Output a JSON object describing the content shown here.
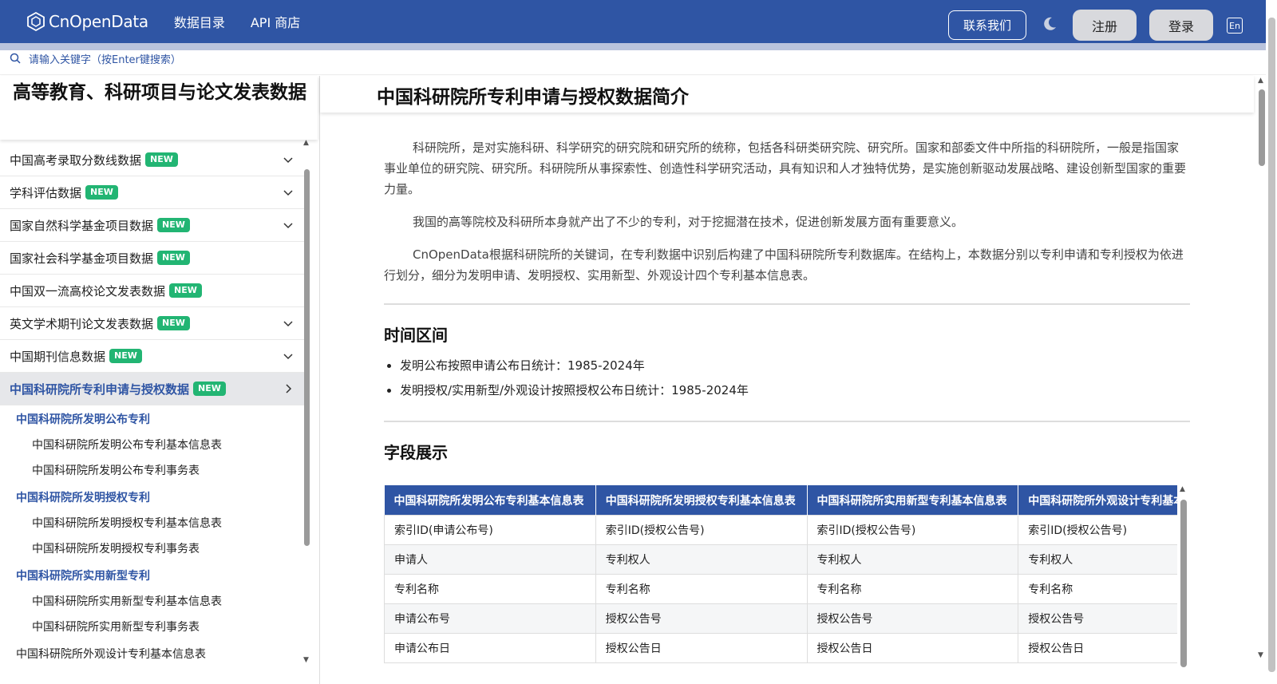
{
  "header": {
    "logo_text": "CnOpenData",
    "nav": [
      "数据目录",
      "API 商店"
    ],
    "contact": "联系我们",
    "register": "注册",
    "login": "登录",
    "lang": "En"
  },
  "search": {
    "placeholder": "请输入关键字（按Enter键搜索）"
  },
  "sidebar": {
    "title": "高等教育、科研项目与论文发表数据",
    "items": [
      {
        "label": "中国高考录取分数线数据",
        "badge": "NEW"
      },
      {
        "label": "学科评估数据",
        "badge": "NEW"
      },
      {
        "label": "国家自然科学基金项目数据",
        "badge": "NEW"
      },
      {
        "label": "国家社会科学基金项目数据",
        "badge": "NEW"
      },
      {
        "label": "中国双一流高校论文发表数据",
        "badge": "NEW"
      },
      {
        "label": "英文学术期刊论文发表数据",
        "badge": "NEW"
      },
      {
        "label": "中国期刊信息数据",
        "badge": "NEW"
      },
      {
        "label": "中国科研院所专利申请与授权数据",
        "badge": "NEW"
      }
    ],
    "sub": {
      "group1": "中国科研院所发明公布专利",
      "group1_items": [
        "中国科研院所发明公布专利基本信息表",
        "中国科研院所发明公布专利事务表"
      ],
      "group2": "中国科研院所发明授权专利",
      "group2_items": [
        "中国科研院所发明授权专利基本信息表",
        "中国科研院所发明授权专利事务表"
      ],
      "group3": "中国科研院所实用新型专利",
      "group3_items": [
        "中国科研院所实用新型专利基本信息表",
        "中国科研院所实用新型专利事务表"
      ],
      "last": "中国科研院所外观设计专利基本信息表"
    }
  },
  "main": {
    "title": "中国科研院所专利申请与授权数据简介",
    "paragraphs": [
      "科研院所，是对实施科研、科学研究的研究院和研究所的统称，包括各科研类研究院、研究所。国家和部委文件中所指的科研院所，一般是指国家事业单位的研究院、研究所。科研院所从事探索性、创造性科学研究活动，具有知识和人才独特优势，是实施创新驱动发展战略、建设创新型国家的重要力量。",
      "我国的高等院校及科研所本身就产出了不少的专利，对于挖掘潜在技术，促进创新发展方面有重要意义。",
      "CnOpenData根据科研院所的关键词，在专利数据中识别后构建了中国科研院所专利数据库。在结构上，本数据分别以专利申请和专利授权为依进行划分，细分为发明申请、发明授权、实用新型、外观设计四个专利基本信息表。"
    ],
    "time_title": "时间区间",
    "time_items": [
      "发明公布按照申请公布日统计：1985-2024年",
      "发明授权/实用新型/外观设计按照授权公布日统计：1985-2024年"
    ],
    "fields_title": "字段展示",
    "table": {
      "headers": [
        "中国科研院所发明公布专利基本信息表",
        "中国科研院所发明授权专利基本信息表",
        "中国科研院所实用新型专利基本信息表",
        "中国科研院所外观设计专利基本信息表"
      ],
      "rows": [
        [
          "索引ID(申请公布号)",
          "索引ID(授权公告号)",
          "索引ID(授权公告号)",
          "索引ID(授权公告号)"
        ],
        [
          "申请人",
          "专利权人",
          "专利权人",
          "专利权人"
        ],
        [
          "专利名称",
          "专利名称",
          "专利名称",
          "专利名称"
        ],
        [
          "申请公布号",
          "授权公告号",
          "授权公告号",
          "授权公告号"
        ],
        [
          "申请公布日",
          "授权公告日",
          "授权公告日",
          "授权公告日"
        ]
      ]
    }
  },
  "colors": {
    "brand": "#2f55a4",
    "badge": "#22b573"
  }
}
